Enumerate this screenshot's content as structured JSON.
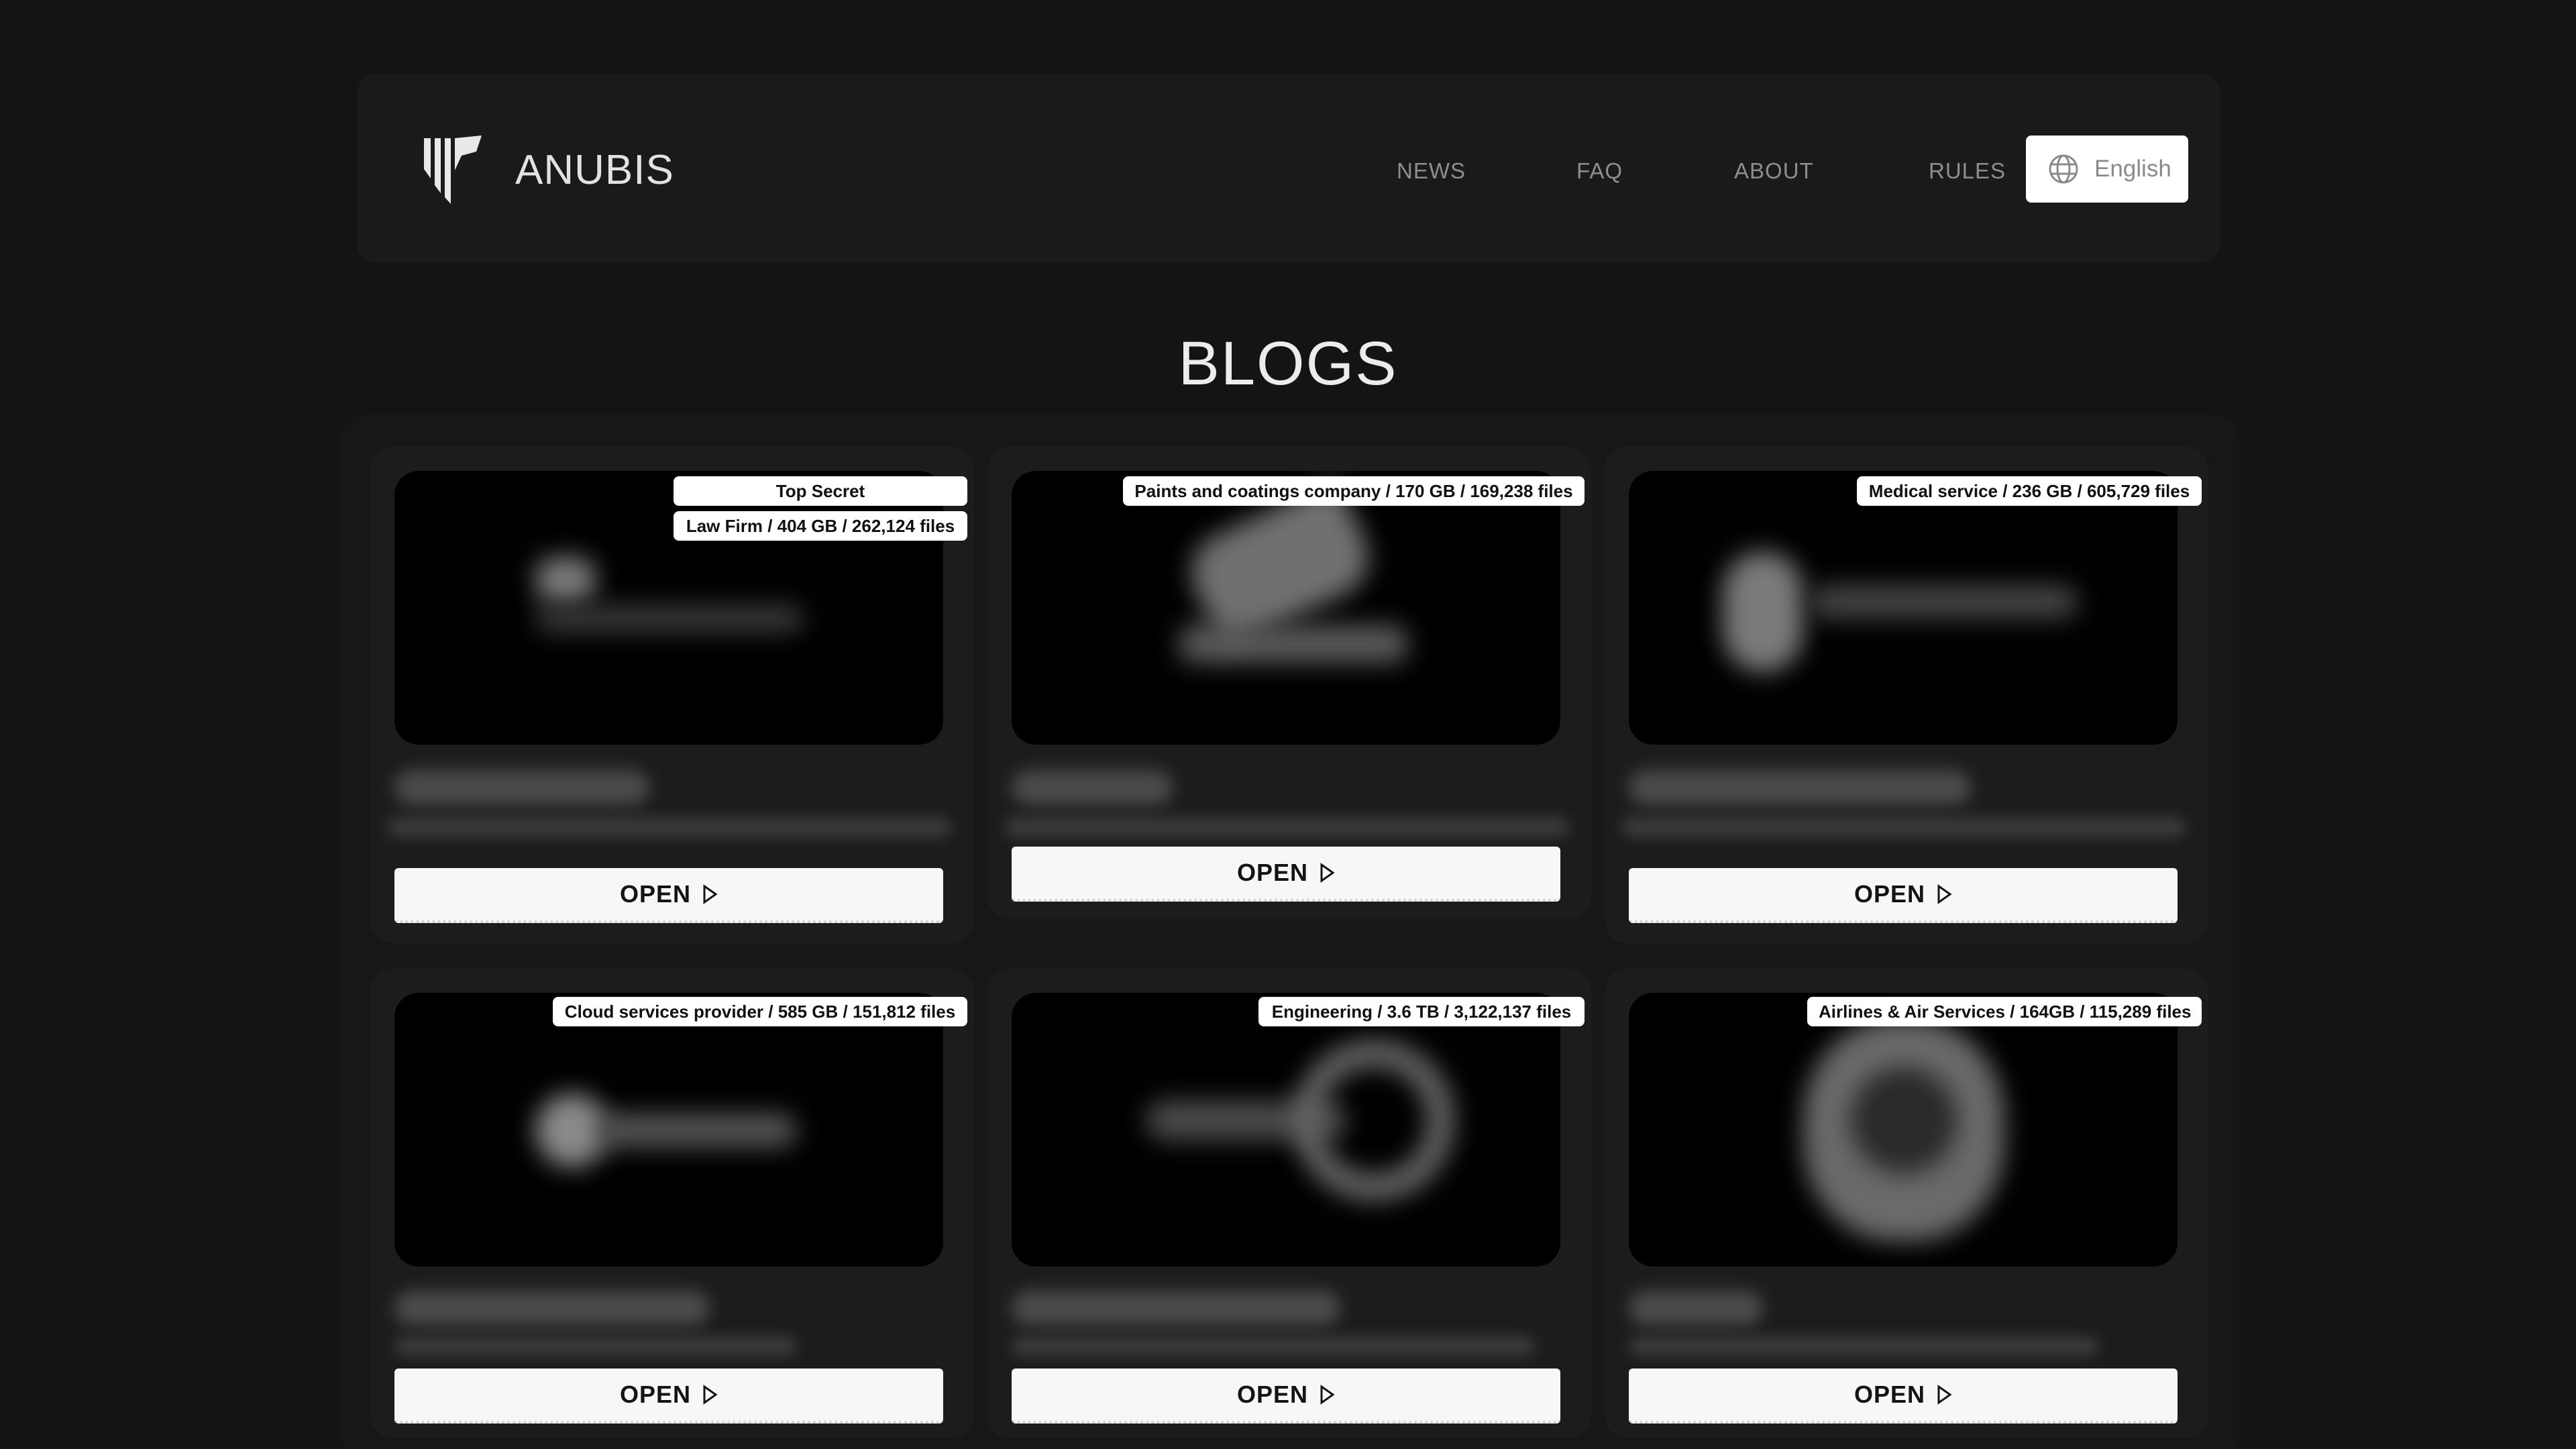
{
  "header": {
    "brand": "ANUBIS",
    "logo_icon": "anubis-logo-icon",
    "nav": [
      {
        "label": "NEWS"
      },
      {
        "label": "FAQ"
      },
      {
        "label": "ABOUT"
      },
      {
        "label": "RULES"
      }
    ],
    "language": {
      "label": "English",
      "icon": "globe-icon"
    }
  },
  "page_title": "BLOGS",
  "cards": [
    {
      "tags": [
        "Top Secret",
        "Law Firm / 404 GB / 262,124 files"
      ],
      "open_label": "OPEN",
      "open_icon": "play-triangle-icon"
    },
    {
      "tags": [
        "Paints and coatings company / 170 GB / 169,238 files"
      ],
      "open_label": "OPEN",
      "open_icon": "play-triangle-icon"
    },
    {
      "tags": [
        "Medical service / 236 GB / 605,729 files"
      ],
      "open_label": "OPEN",
      "open_icon": "play-triangle-icon"
    },
    {
      "tags": [
        "Cloud services provider / 585 GB / 151,812 files"
      ],
      "open_label": "OPEN",
      "open_icon": "play-triangle-icon"
    },
    {
      "tags": [
        "Engineering / 3.6 TB / 3,122,137 files"
      ],
      "open_label": "OPEN",
      "open_icon": "play-triangle-icon"
    },
    {
      "tags": [
        "Airlines & Air Services / 164GB / 115,289 files"
      ],
      "open_label": "OPEN",
      "open_icon": "play-triangle-icon"
    }
  ],
  "colors": {
    "background": "#141414",
    "panel": "#1a1a1a",
    "card": "#1c1c1c",
    "thumbnail": "#000000",
    "button": "#f7f7f7"
  }
}
